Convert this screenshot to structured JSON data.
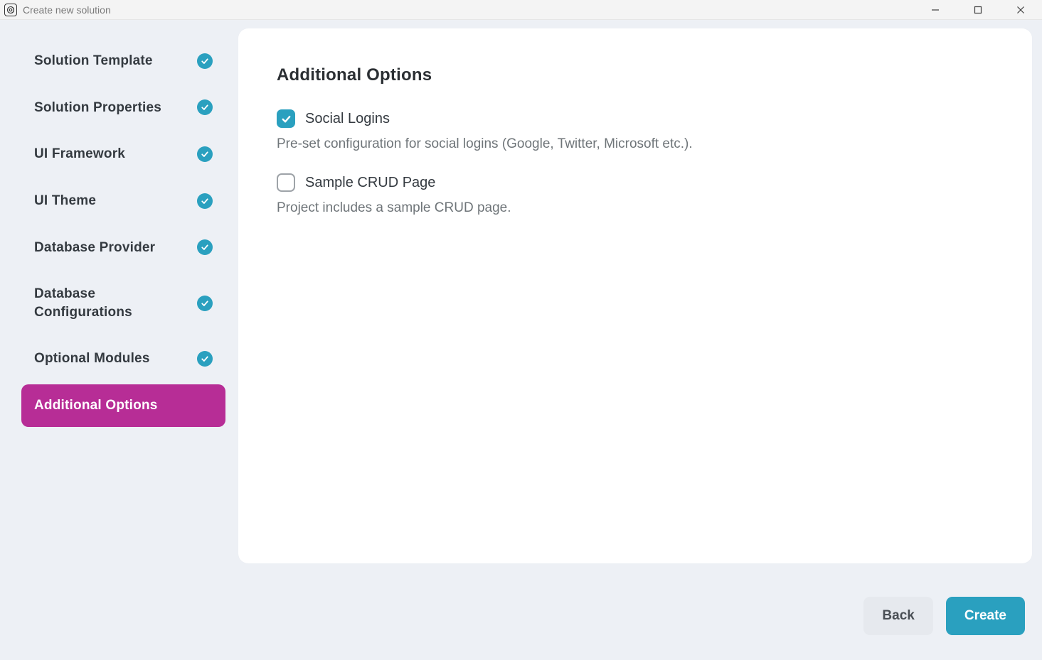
{
  "window": {
    "title": "Create new solution"
  },
  "sidebar": {
    "steps": [
      {
        "label": "Solution Template",
        "completed": true,
        "active": false
      },
      {
        "label": "Solution Properties",
        "completed": true,
        "active": false
      },
      {
        "label": "UI Framework",
        "completed": true,
        "active": false
      },
      {
        "label": "UI Theme",
        "completed": true,
        "active": false
      },
      {
        "label": "Database Provider",
        "completed": true,
        "active": false
      },
      {
        "label": "Database Configurations",
        "completed": true,
        "active": false
      },
      {
        "label": "Optional Modules",
        "completed": true,
        "active": false
      },
      {
        "label": "Additional Options",
        "completed": false,
        "active": true
      }
    ]
  },
  "main": {
    "heading": "Additional Options",
    "options": [
      {
        "title": "Social Logins",
        "description": "Pre-set configuration for social logins (Google, Twitter, Microsoft etc.).",
        "checked": true
      },
      {
        "title": "Sample CRUD Page",
        "description": "Project includes a sample CRUD page.",
        "checked": false
      }
    ]
  },
  "footer": {
    "back": "Back",
    "create": "Create"
  },
  "colors": {
    "accent": "#2aa0bf",
    "activeStep": "#b72d96"
  }
}
